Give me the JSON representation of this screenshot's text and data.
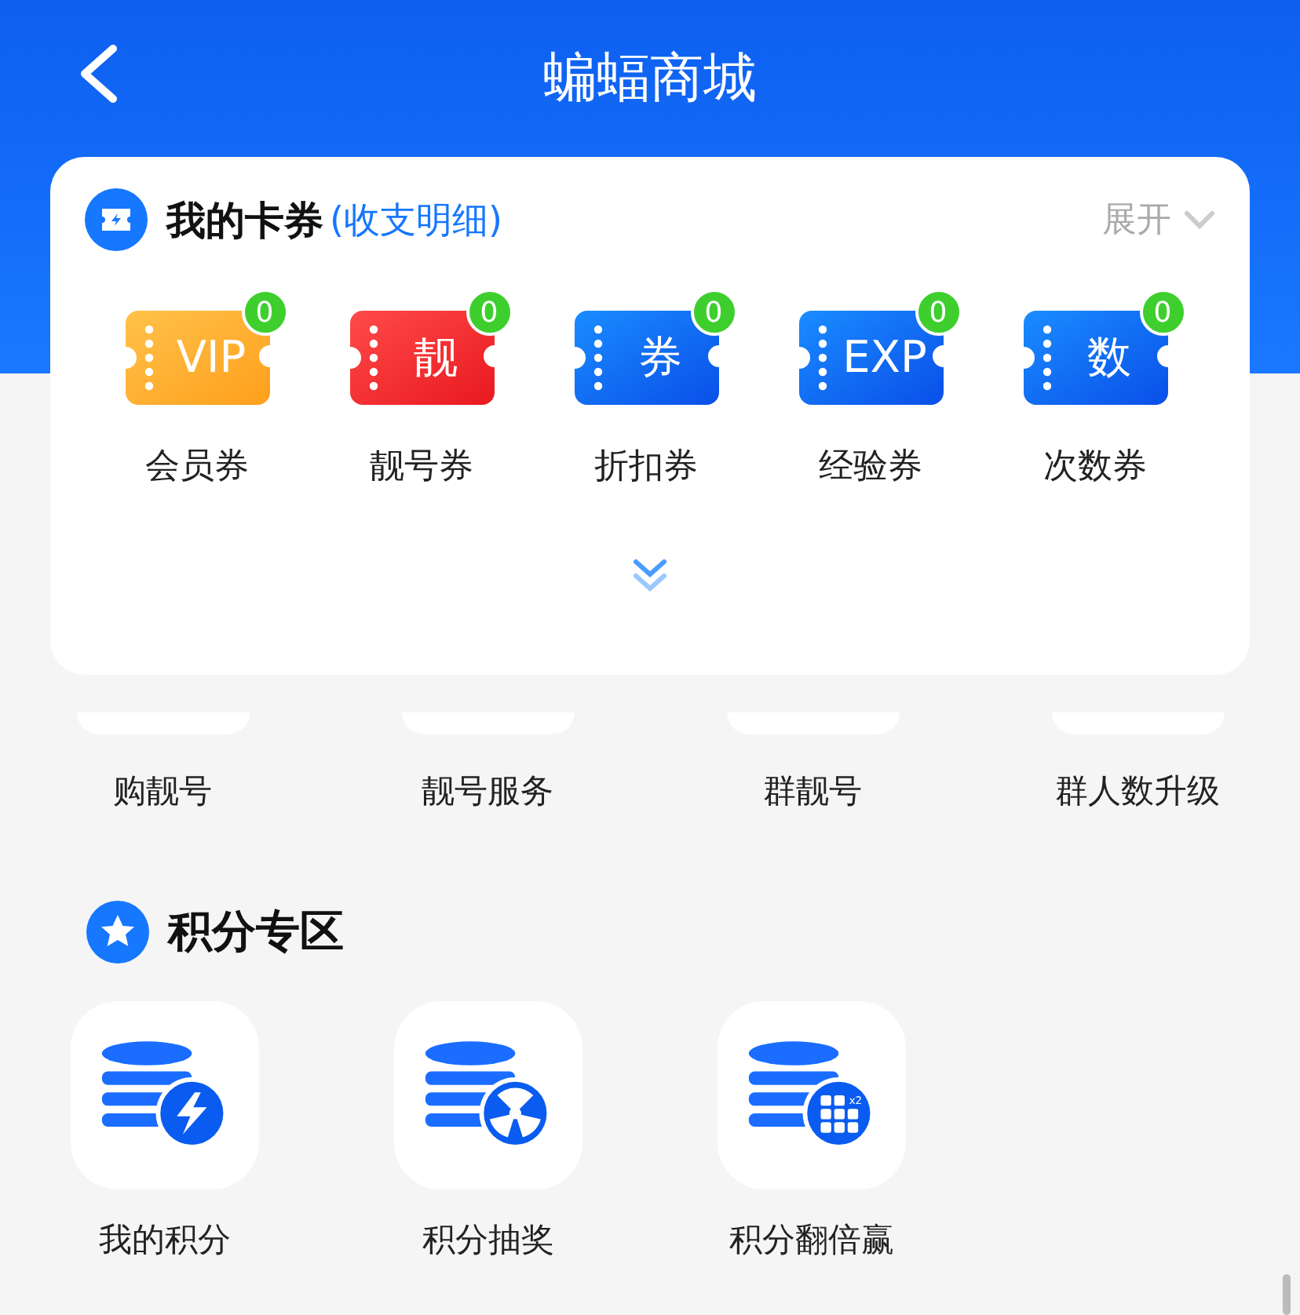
{
  "header": {
    "title": "蝙蝠商城"
  },
  "coupons": {
    "title": "我的卡券",
    "link": "(收支明细)",
    "toggle": "展开",
    "items": [
      {
        "kind": "gold",
        "glyph": "VIP",
        "count": "0",
        "label": "会员券"
      },
      {
        "kind": "red",
        "glyph": "靓",
        "count": "0",
        "label": "靓号券"
      },
      {
        "kind": "blue",
        "glyph": "券",
        "count": "0",
        "label": "折扣券"
      },
      {
        "kind": "blue",
        "glyph": "EXP",
        "count": "0",
        "label": "经验券"
      },
      {
        "kind": "blue",
        "glyph": "数",
        "count": "0",
        "label": "次数券"
      }
    ]
  },
  "services": {
    "items": [
      {
        "label": "购靓号"
      },
      {
        "label": "靓号服务"
      },
      {
        "label": "群靓号"
      },
      {
        "label": "群人数升级"
      }
    ]
  },
  "points": {
    "title": "积分专区",
    "items": [
      {
        "kind": "bolt",
        "label": "我的积分"
      },
      {
        "kind": "wheel",
        "label": "积分抽奖"
      },
      {
        "kind": "grid",
        "label": "积分翻倍赢",
        "icon_text": "x2"
      }
    ]
  }
}
